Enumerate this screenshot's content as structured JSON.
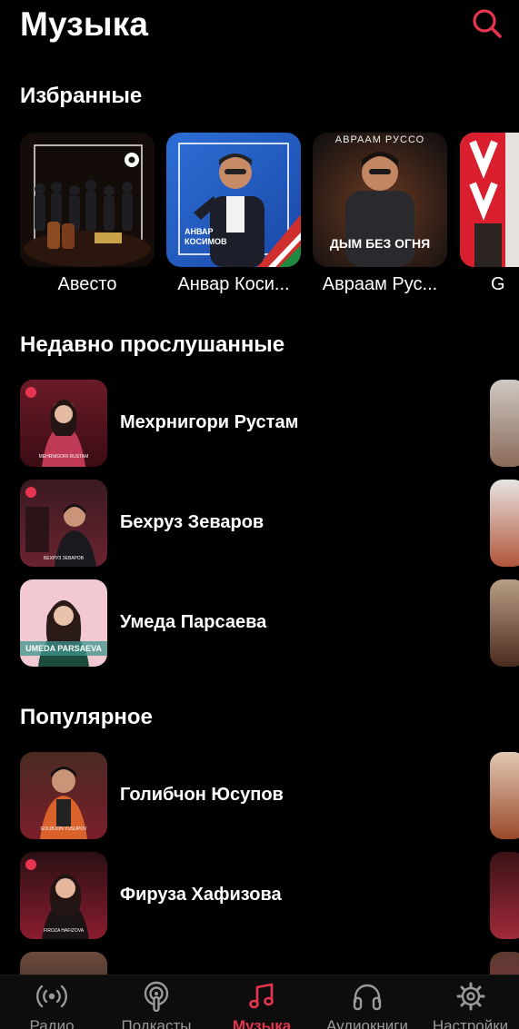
{
  "header": {
    "title": "Музыка",
    "search_icon": "search-icon"
  },
  "accent_color": "#e5354f",
  "favorites": {
    "title": "Избранные",
    "items": [
      {
        "label": "Авесто"
      },
      {
        "label": "Анвар Косимов",
        "display": "Анвар Коси...",
        "cover_text": "АНВАР КОСИМОВ"
      },
      {
        "label": "Авраам Руссо",
        "display": "Авраам Рус...",
        "cover_top": "АВРААМ РУССО",
        "cover_bottom": "ДЫМ БЕЗ ОГНЯ"
      },
      {
        "label": "G"
      }
    ]
  },
  "recent": {
    "title": "Недавно прослушанные",
    "items": [
      {
        "label": "Мехрнигори Рустам",
        "cover_text": "MEHRNIGORI RUSTAM"
      },
      {
        "label": "Бехруз Зеваров",
        "cover_text": "БЕХРУЗ ЗЕВАРОВ"
      },
      {
        "label": "Умеда Парсаева",
        "cover_text": "UMEDA PARSAEVA"
      }
    ]
  },
  "popular": {
    "title": "Популярное",
    "items": [
      {
        "label": "Голибчон Юсупов",
        "cover_text": "GOLIBJON YUSUPOV"
      },
      {
        "label": "Фируза Хафизова",
        "cover_text": "FIROZA HAFIZOVA"
      }
    ]
  },
  "tabs": [
    {
      "label": "Радио",
      "icon": "radio-icon",
      "active": false
    },
    {
      "label": "Подкасты",
      "icon": "podcast-icon",
      "active": false
    },
    {
      "label": "Музыка",
      "icon": "music-note-icon",
      "active": true
    },
    {
      "label": "Аудиокниги",
      "icon": "headphones-icon",
      "active": false
    },
    {
      "label": "Настройки",
      "icon": "gear-icon",
      "active": false
    }
  ]
}
